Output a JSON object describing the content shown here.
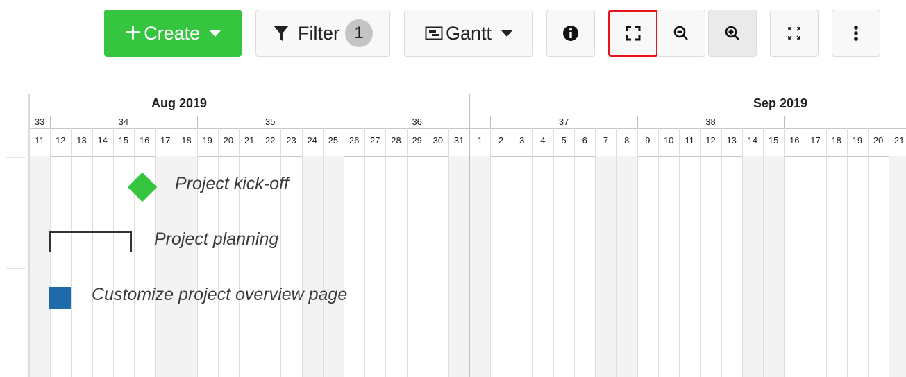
{
  "toolbar": {
    "create_label": "Create",
    "filter_label": "Filter",
    "filter_count": "1",
    "view_label": "Gantt"
  },
  "timeline": {
    "months": [
      {
        "label": "Aug 2019"
      },
      {
        "label": "Sep 2019"
      }
    ],
    "weeks": [
      "33",
      "34",
      "35",
      "36",
      "37",
      "38"
    ],
    "days": [
      "11",
      "12",
      "13",
      "14",
      "15",
      "16",
      "17",
      "18",
      "19",
      "20",
      "21",
      "22",
      "23",
      "24",
      "25",
      "26",
      "27",
      "28",
      "29",
      "30",
      "31",
      "1",
      "2",
      "3",
      "4",
      "5",
      "6",
      "7",
      "8",
      "9",
      "10",
      "11",
      "12",
      "13",
      "14",
      "15",
      "16",
      "17",
      "18",
      "19",
      "20",
      "21"
    ]
  },
  "items": [
    {
      "name": "Project kick-off",
      "type": "milestone",
      "color": "#35c53f"
    },
    {
      "name": "Project planning",
      "type": "phase",
      "color": "#333333"
    },
    {
      "name": "Customize project overview page",
      "type": "task",
      "color": "#1f6aa8"
    }
  ],
  "colors": {
    "create_green": "#35c53f",
    "highlight_red": "#e8141c",
    "task_blue": "#1f6aa8"
  }
}
